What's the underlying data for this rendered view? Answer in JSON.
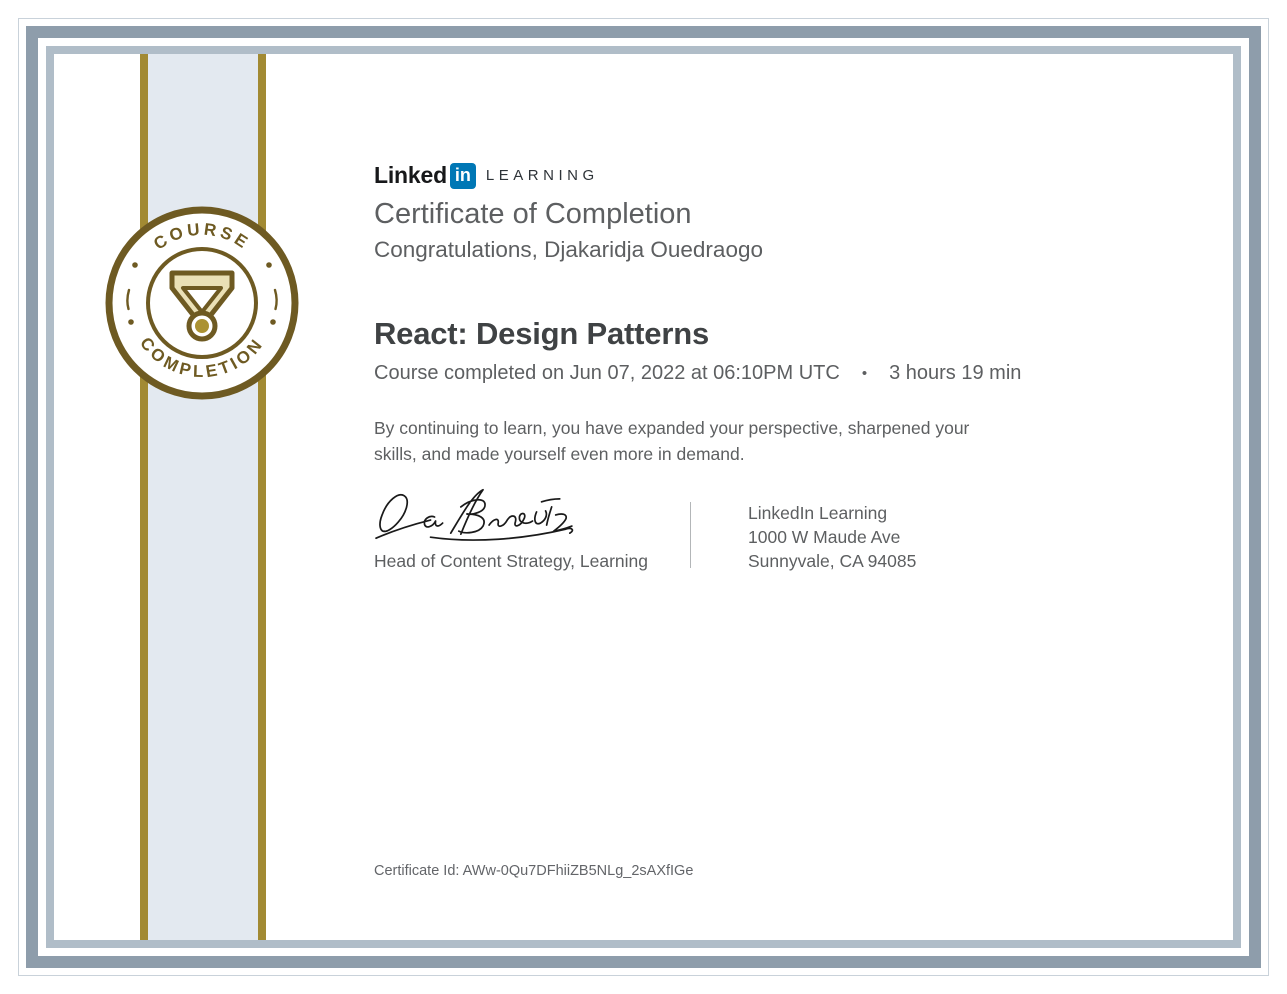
{
  "colors": {
    "slate-dark": "#8e9dab",
    "slate-light": "#b0bdc8",
    "slate-line": "#c9d2da",
    "gold-stripe": "#a28a33",
    "gold-dark": "#6e5a22",
    "gold-mid": "#ab9232",
    "tan": "#eae0b6",
    "band-blue": "#e3e9f0",
    "linkedin-blue": "#0077b5",
    "text-gray": "#5d5f61",
    "text-dark": "#3f4244"
  },
  "brand": {
    "linked": "Linked",
    "in_badge": "in",
    "learning": "LEARNING"
  },
  "heading": "Certificate of Completion",
  "greeting": "Congratulations, Djakaridja Ouedraogo",
  "course": {
    "title": "React: Design Patterns",
    "completed_line": "Course completed on Jun 07, 2022 at 06:10PM UTC",
    "separator": "•",
    "duration": "3 hours 19 min"
  },
  "message": "By continuing to learn, you have expanded your perspective, sharpened your skills, and made yourself even more in demand.",
  "signature": {
    "signer_title": "Head of Content Strategy, Learning"
  },
  "issuer": {
    "lines": [
      "LinkedIn Learning",
      "1000 W Maude Ave",
      "Sunnyvale, CA 94085"
    ]
  },
  "footer": {
    "certificate_id": "Certificate Id: AWw-0Qu7DFhiiZB5NLg_2sAXfIGe"
  },
  "badge": {
    "arc_top": "COURSE",
    "arc_bottom": "COMPLETION",
    "icon": "medal-ribbon-icon"
  }
}
